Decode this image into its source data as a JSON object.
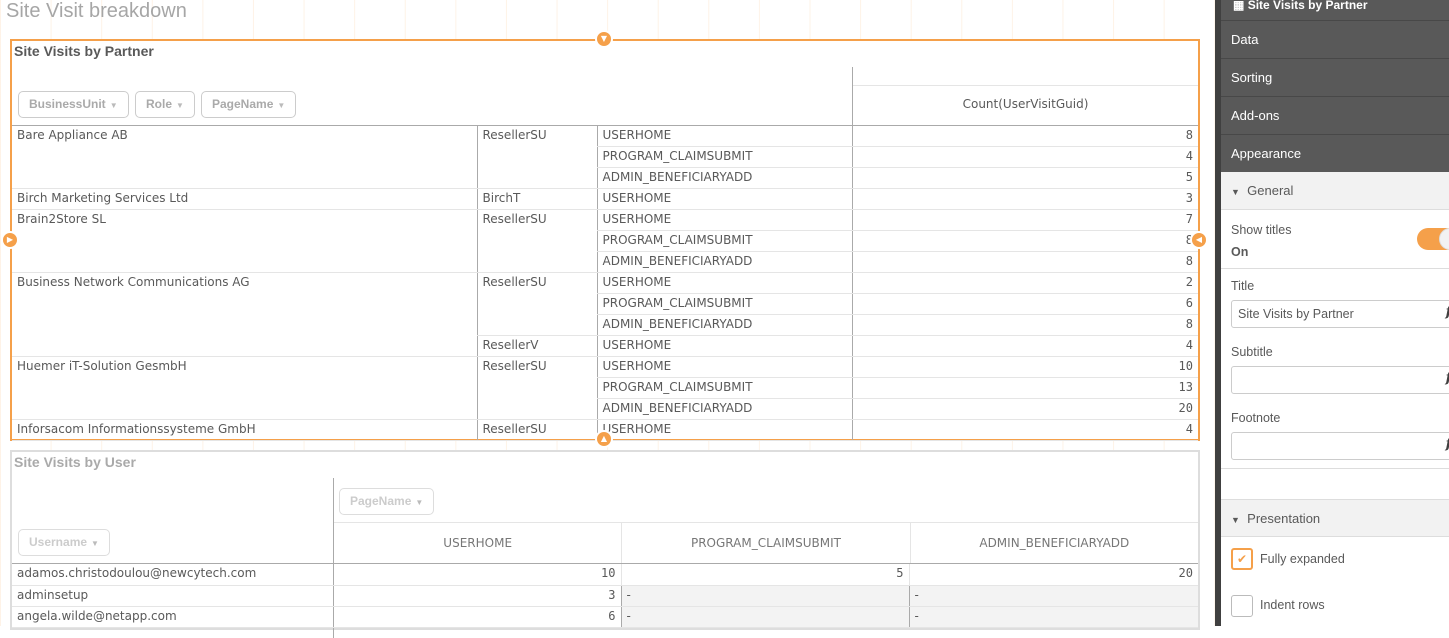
{
  "sheet_title": "Site Visit breakdown",
  "partner_table": {
    "title": "Site Visits by Partner",
    "dimensions": [
      "BusinessUnit",
      "Role",
      "PageName"
    ],
    "measure": "Count(UserVisitGuid)",
    "rows": [
      [
        "Bare Appliance AB",
        "ResellerSU",
        "USERHOME",
        "8"
      ],
      [
        "Bare Appliance AB",
        "ResellerSU",
        "PROGRAM_CLAIMSUBMIT",
        "4"
      ],
      [
        "Bare Appliance AB",
        "ResellerSU",
        "ADMIN_BENEFICIARYADD",
        "5"
      ],
      [
        "Birch Marketing Services Ltd",
        "BirchT",
        "USERHOME",
        "3"
      ],
      [
        "Brain2Store SL",
        "ResellerSU",
        "USERHOME",
        "7"
      ],
      [
        "Brain2Store SL",
        "ResellerSU",
        "PROGRAM_CLAIMSUBMIT",
        "8"
      ],
      [
        "Brain2Store SL",
        "ResellerSU",
        "ADMIN_BENEFICIARYADD",
        "8"
      ],
      [
        "Business Network Communications AG",
        "ResellerSU",
        "USERHOME",
        "2"
      ],
      [
        "Business Network Communications AG",
        "ResellerSU",
        "PROGRAM_CLAIMSUBMIT",
        "6"
      ],
      [
        "Business Network Communications AG",
        "ResellerSU",
        "ADMIN_BENEFICIARYADD",
        "8"
      ],
      [
        "Business Network Communications AG",
        "ResellerV",
        "USERHOME",
        "4"
      ],
      [
        "Huemer iT-Solution GesmbH",
        "ResellerSU",
        "USERHOME",
        "10"
      ],
      [
        "Huemer iT-Solution GesmbH",
        "ResellerSU",
        "PROGRAM_CLAIMSUBMIT",
        "13"
      ],
      [
        "Huemer iT-Solution GesmbH",
        "ResellerSU",
        "ADMIN_BENEFICIARYADD",
        "20"
      ],
      [
        "Inforsacom Informationssysteme GmbH",
        "ResellerSU",
        "USERHOME",
        "4"
      ]
    ]
  },
  "user_table": {
    "title": "Site Visits by User",
    "row_dimension": "Username",
    "column_dimension": "PageName",
    "columns": [
      "USERHOME",
      "PROGRAM_CLAIMSUBMIT",
      "ADMIN_BENEFICIARYADD"
    ],
    "rows": [
      [
        "adamos.christodoulou@newcytech.com",
        "10",
        "5",
        "20"
      ],
      [
        "adminsetup",
        "3",
        "-",
        "-"
      ],
      [
        "angela.wilde@netapp.com",
        "6",
        "-",
        "-"
      ]
    ]
  },
  "panel": {
    "header": "Site Visits by Partner",
    "menu": [
      "Data",
      "Sorting",
      "Add-ons",
      "Appearance"
    ],
    "general": "General",
    "show_titles_label": "Show titles",
    "show_titles_value": "On",
    "title_label": "Title",
    "title_value": "Site Visits by Partner",
    "subtitle_label": "Subtitle",
    "subtitle_value": "",
    "footnote_label": "Footnote",
    "footnote_value": "",
    "fx": "fx",
    "presentation": "Presentation",
    "fully_expanded": "Fully expanded",
    "indent_rows": "Indent rows"
  },
  "colors": {
    "accent": "#f5a04a",
    "panel": "#595959"
  }
}
